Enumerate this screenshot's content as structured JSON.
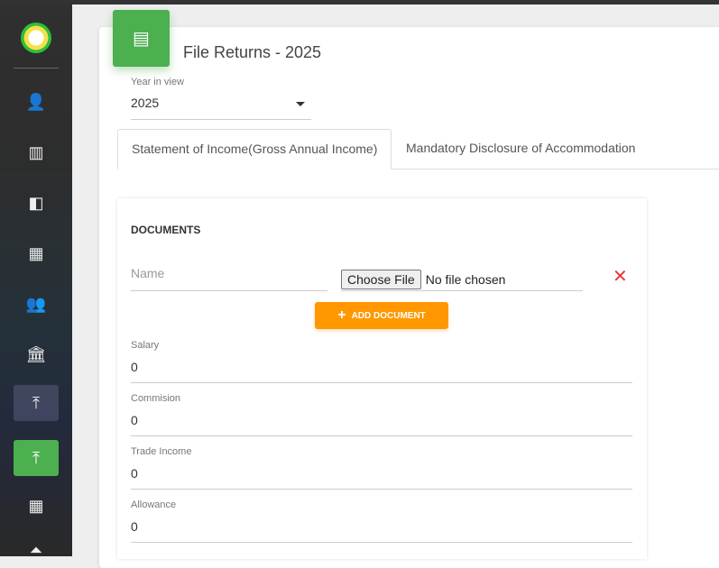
{
  "sidebar": {
    "items": [
      {
        "icon": "person-icon",
        "glyph": "👤"
      },
      {
        "icon": "chart-icon",
        "glyph": "▥"
      },
      {
        "icon": "compare-icon",
        "glyph": "◧"
      },
      {
        "icon": "building-icon",
        "glyph": "▦"
      },
      {
        "icon": "people-icon",
        "glyph": "👥"
      },
      {
        "icon": "bank-icon",
        "glyph": "🏛"
      },
      {
        "icon": "upload-icon",
        "glyph": "⤒"
      },
      {
        "icon": "upload-icon",
        "glyph": "⤒"
      },
      {
        "icon": "building-icon",
        "glyph": "▦"
      },
      {
        "icon": "eject-icon",
        "glyph": "⏶"
      }
    ]
  },
  "header": {
    "title": "File Returns - 2025",
    "icon": "document-icon"
  },
  "year": {
    "label": "Year in view",
    "value": "2025"
  },
  "tabs": [
    {
      "label": "Statement of Income(Gross Annual Income)"
    },
    {
      "label": "Mandatory Disclosure of Accommodation"
    }
  ],
  "documents": {
    "heading": "DOCUMENTS",
    "name_placeholder": "Name",
    "choose_file": "Choose File",
    "no_file": "No file chosen",
    "add_label": "ADD DOCUMENT"
  },
  "fields": [
    {
      "label": "Salary",
      "value": "0"
    },
    {
      "label": "Commision",
      "value": "0"
    },
    {
      "label": "Trade Income",
      "value": "0"
    },
    {
      "label": "Allowance",
      "value": "0"
    }
  ],
  "colors": {
    "accent": "#4caf50",
    "button": "#ff9800",
    "delete": "#e53935"
  }
}
